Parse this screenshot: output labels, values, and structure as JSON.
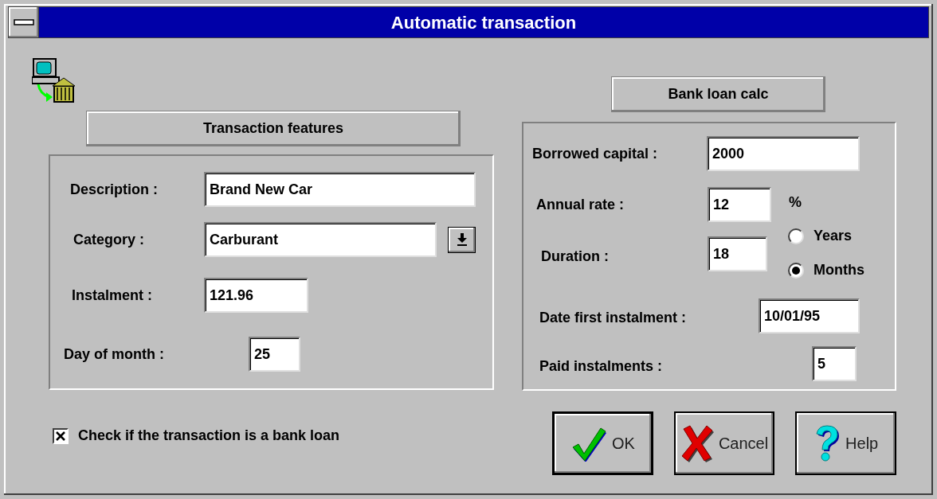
{
  "window": {
    "title": "Automatic transaction"
  },
  "transaction_features": {
    "heading": "Transaction features",
    "description": {
      "label": "Description :",
      "value": "Brand New Car"
    },
    "category": {
      "label": "Category :",
      "value": "Carburant"
    },
    "instalment": {
      "label": "Instalment :",
      "value": "121.96"
    },
    "day_of_month": {
      "label": "Day of month :",
      "value": "25"
    }
  },
  "bank_loan_calc": {
    "heading": "Bank loan calc",
    "borrowed_capital": {
      "label": "Borrowed capital :",
      "value": "2000"
    },
    "annual_rate": {
      "label": "Annual rate :",
      "value": "12",
      "unit": "%"
    },
    "duration": {
      "label": "Duration :",
      "value": "18",
      "units": [
        {
          "label": "Years",
          "selected": false
        },
        {
          "label": "Months",
          "selected": true
        }
      ]
    },
    "date_first_instalment": {
      "label": "Date first instalment :",
      "value": "10/01/95"
    },
    "paid_instalments": {
      "label": "Paid instalments :",
      "value": "5"
    }
  },
  "bank_loan_checkbox": {
    "label": "Check if the transaction is a bank loan",
    "checked": true
  },
  "buttons": [
    {
      "label": "OK",
      "kind": "ok",
      "default": true
    },
    {
      "label": "Cancel",
      "kind": "cancel",
      "default": false
    },
    {
      "label": "Help",
      "kind": "help",
      "default": false
    }
  ]
}
